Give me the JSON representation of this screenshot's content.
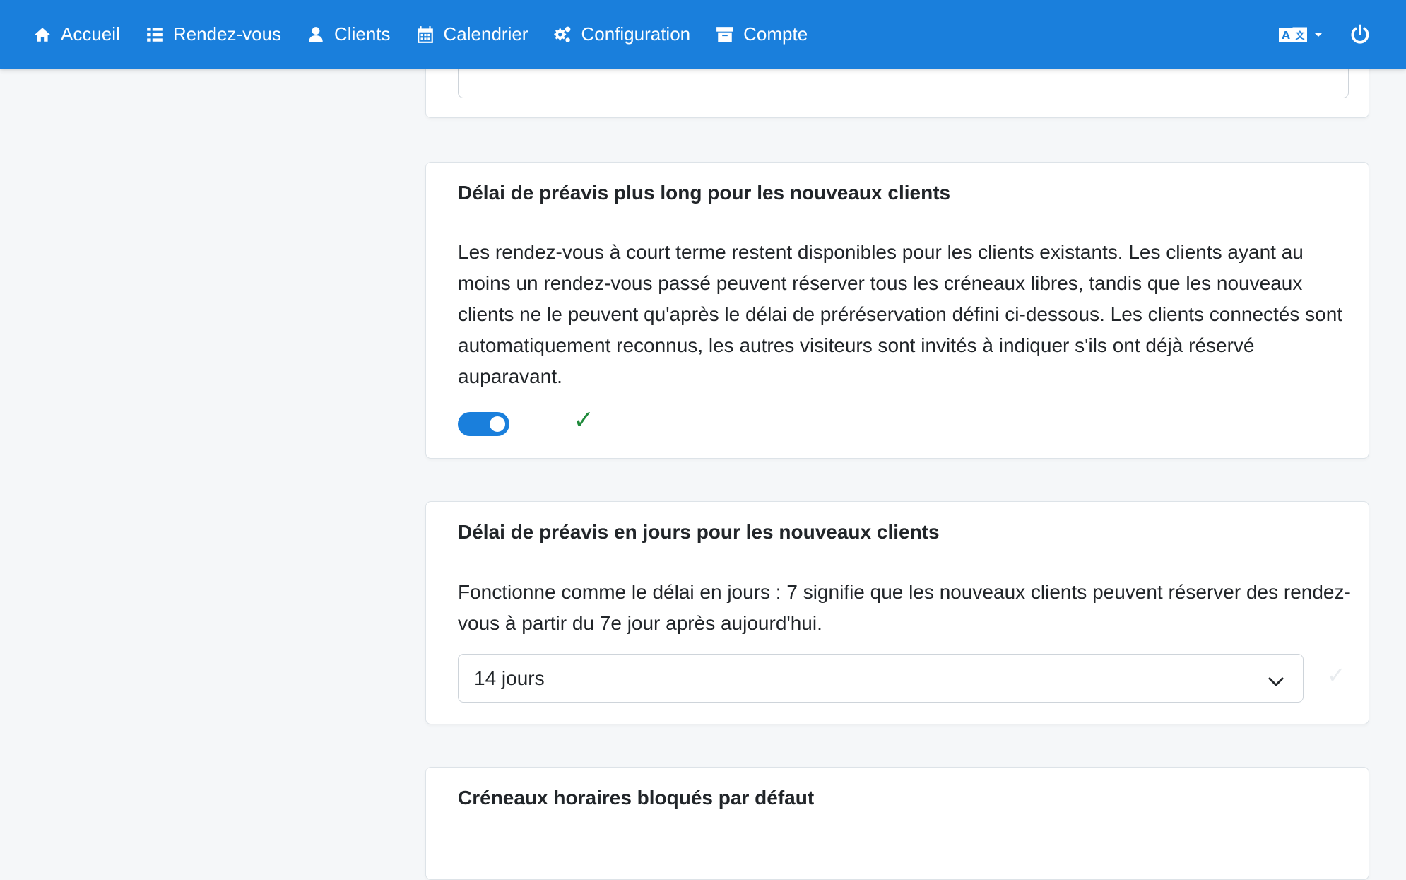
{
  "navbar": {
    "items": [
      {
        "label": "Accueil",
        "icon": "home-icon"
      },
      {
        "label": "Rendez-vous",
        "icon": "list-icon"
      },
      {
        "label": "Clients",
        "icon": "user-icon"
      },
      {
        "label": "Calendrier",
        "icon": "calendar-icon"
      },
      {
        "label": "Configuration",
        "icon": "gears-icon"
      },
      {
        "label": "Compte",
        "icon": "archive-icon"
      }
    ],
    "right": {
      "language_icon": "language-icon",
      "power_icon": "power-icon"
    },
    "color": "#1a7fdc"
  },
  "cards": {
    "new_clients_notice": {
      "title": "Délai de préavis plus long pour les nouveaux clients",
      "description": "Les rendez-vous à court terme restent disponibles pour les clients existants. Les clients ayant au moins un rendez-vous passé peuvent réserver tous les créneaux libres, tandis que les nouveaux clients ne le peuvent qu'après le délai de préréservation défini ci-dessous. Les clients connectés sont automatiquement reconnus, les autres visiteurs sont invités à indiquer s'ils ont déjà réservé auparavant.",
      "toggle_on": true,
      "saved_mark": "✓"
    },
    "notice_days": {
      "title": "Délai de préavis en jours pour les nouveaux clients",
      "description": "Fonctionne comme le délai en jours : 7 signifie que les nouveaux clients peuvent réserver des rendez-vous à partir du 7e jour après aujourd'hui.",
      "selected": "14 jours",
      "saved_mark": "✓"
    },
    "blocked_slots": {
      "title": "Créneaux horaires bloqués par défaut"
    }
  },
  "colors": {
    "accent": "#1a7fdc",
    "success": "#1f8a3b",
    "background": "#f5f7f9"
  }
}
